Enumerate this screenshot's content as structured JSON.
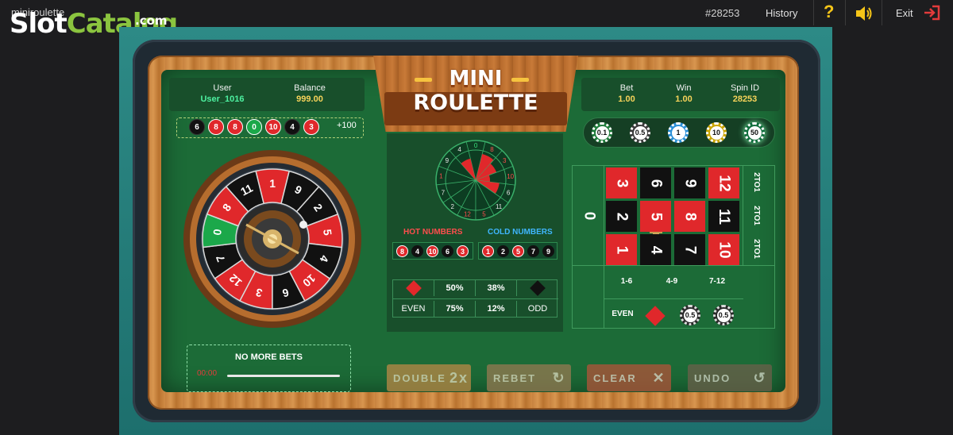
{
  "topbar": {
    "app_title": "miniroulette",
    "logo": {
      "slot": "Slot",
      "catalog": "Catalog",
      "com": ".com"
    },
    "game_id": "#28253",
    "history": "History",
    "help": "?",
    "exit": "Exit"
  },
  "title": {
    "mini": "MINI",
    "roulette": "ROULETTE"
  },
  "player": {
    "user_label": "User",
    "user_value": "User_1016",
    "balance_label": "Balance",
    "balance_value": "999.00"
  },
  "round": {
    "bet_label": "Bet",
    "bet_value": "1.00",
    "win_label": "Win",
    "win_value": "1.00",
    "spin_label": "Spin ID",
    "spin_value": "28253"
  },
  "history": {
    "balls": [
      {
        "n": "6",
        "c": "black"
      },
      {
        "n": "8",
        "c": "red"
      },
      {
        "n": "8",
        "c": "red"
      },
      {
        "n": "0",
        "c": "green"
      },
      {
        "n": "10",
        "c": "red"
      },
      {
        "n": "4",
        "c": "black"
      },
      {
        "n": "3",
        "c": "red"
      }
    ],
    "extra": "+100"
  },
  "stats": {
    "hot_label": "HOT NUMBERS",
    "cold_label": "COLD NUMBERS",
    "hot": [
      {
        "n": "8",
        "c": "red"
      },
      {
        "n": "4",
        "c": "black"
      },
      {
        "n": "10",
        "c": "red"
      },
      {
        "n": "6",
        "c": "black"
      },
      {
        "n": "3",
        "c": "red"
      }
    ],
    "cold": [
      {
        "n": "1",
        "c": "red"
      },
      {
        "n": "2",
        "c": "black"
      },
      {
        "n": "5",
        "c": "red"
      },
      {
        "n": "7",
        "c": "black"
      },
      {
        "n": "9",
        "c": "black"
      }
    ],
    "red_pct": "50%",
    "black_pct": "38%",
    "even_label": "EVEN",
    "even_pct": "75%",
    "odd_pct": "12%",
    "odd_label": "ODD"
  },
  "wheel_numbers": [
    "1",
    "9",
    "2",
    "5",
    "4",
    "10",
    "6",
    "3",
    "12",
    "7",
    "0",
    "8",
    "11"
  ],
  "mini_wheel_numbers": [
    "0",
    "8",
    "3",
    "10",
    "6",
    "11",
    "5",
    "12",
    "2",
    "7",
    "1",
    "9",
    "4"
  ],
  "status": {
    "no_more_bets": "NO MORE BETS",
    "timer": "00:00"
  },
  "chips": [
    "0.1",
    "0.5",
    "1",
    "10",
    "50"
  ],
  "board": {
    "zero": "0",
    "rows": [
      [
        {
          "n": "3",
          "c": "red"
        },
        {
          "n": "6",
          "c": "black"
        },
        {
          "n": "9",
          "c": "black"
        },
        {
          "n": "12",
          "c": "red"
        }
      ],
      [
        {
          "n": "2",
          "c": "black"
        },
        {
          "n": "5",
          "c": "red"
        },
        {
          "n": "8",
          "c": "red"
        },
        {
          "n": "11",
          "c": "black"
        }
      ],
      [
        {
          "n": "1",
          "c": "red"
        },
        {
          "n": "4",
          "c": "black"
        },
        {
          "n": "7",
          "c": "black"
        },
        {
          "n": "10",
          "c": "red"
        }
      ]
    ],
    "columns": [
      "2TO1",
      "2TO1",
      "2TO1"
    ],
    "dozens": [
      "1-6",
      "4-9",
      "7-12"
    ],
    "even": "EVEN",
    "chip_a": "0.5",
    "chip_b": "0.5"
  },
  "buttons": {
    "double": "DOUBLE",
    "double_icon": "2x",
    "rebet": "REBET",
    "clear": "CLEAR",
    "undo": "UNDO"
  },
  "colors": {
    "felt": "#1c6b37",
    "red": "#e0282b",
    "black": "#111111",
    "gold": "#f6c33f"
  }
}
